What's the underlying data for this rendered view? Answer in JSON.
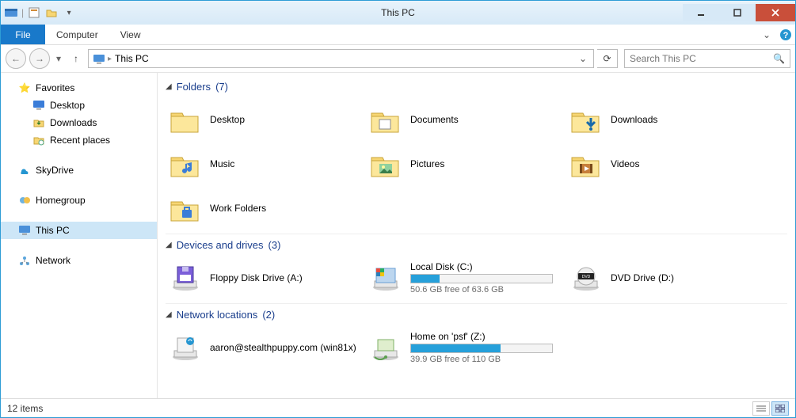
{
  "window": {
    "title": "This PC"
  },
  "ribbon": {
    "file": "File",
    "tabs": [
      "Computer",
      "View"
    ]
  },
  "nav": {
    "address": "This PC",
    "search_placeholder": "Search This PC"
  },
  "tree": {
    "favorites": {
      "label": "Favorites",
      "items": [
        {
          "label": "Desktop",
          "icon": "desktop-icon"
        },
        {
          "label": "Downloads",
          "icon": "downloads-icon"
        },
        {
          "label": "Recent places",
          "icon": "recent-icon"
        }
      ]
    },
    "skydrive": {
      "label": "SkyDrive"
    },
    "homegroup": {
      "label": "Homegroup"
    },
    "thispc": {
      "label": "This PC"
    },
    "network": {
      "label": "Network"
    }
  },
  "groups": {
    "folders": {
      "title": "Folders",
      "count": "(7)",
      "items": [
        {
          "name": "Desktop",
          "icon": "folder-desktop"
        },
        {
          "name": "Documents",
          "icon": "folder-documents"
        },
        {
          "name": "Downloads",
          "icon": "folder-downloads"
        },
        {
          "name": "Music",
          "icon": "folder-music"
        },
        {
          "name": "Pictures",
          "icon": "folder-pictures"
        },
        {
          "name": "Videos",
          "icon": "folder-videos"
        },
        {
          "name": "Work Folders",
          "icon": "folder-work"
        }
      ]
    },
    "drives": {
      "title": "Devices and drives",
      "count": "(3)",
      "items": [
        {
          "name": "Floppy Disk Drive (A:)",
          "icon": "floppy-icon",
          "usage": null,
          "sub": ""
        },
        {
          "name": "Local Disk (C:)",
          "icon": "hdd-icon",
          "usage": 0.205,
          "sub": "50.6 GB free of 63.6 GB"
        },
        {
          "name": "DVD Drive (D:)",
          "icon": "dvd-icon",
          "usage": null,
          "sub": ""
        }
      ]
    },
    "network": {
      "title": "Network locations",
      "count": "(2)",
      "items": [
        {
          "name": "aaron@stealthpuppy.com (win81x)",
          "icon": "netloc-icon",
          "usage": null,
          "sub": ""
        },
        {
          "name": "Home on 'psf' (Z:)",
          "icon": "netdrive-icon",
          "usage": 0.637,
          "sub": "39.9 GB free of 110 GB"
        }
      ]
    }
  },
  "status": {
    "text": "12 items"
  },
  "colors": {
    "accent": "#1979ca",
    "usage": "#26a0da"
  }
}
